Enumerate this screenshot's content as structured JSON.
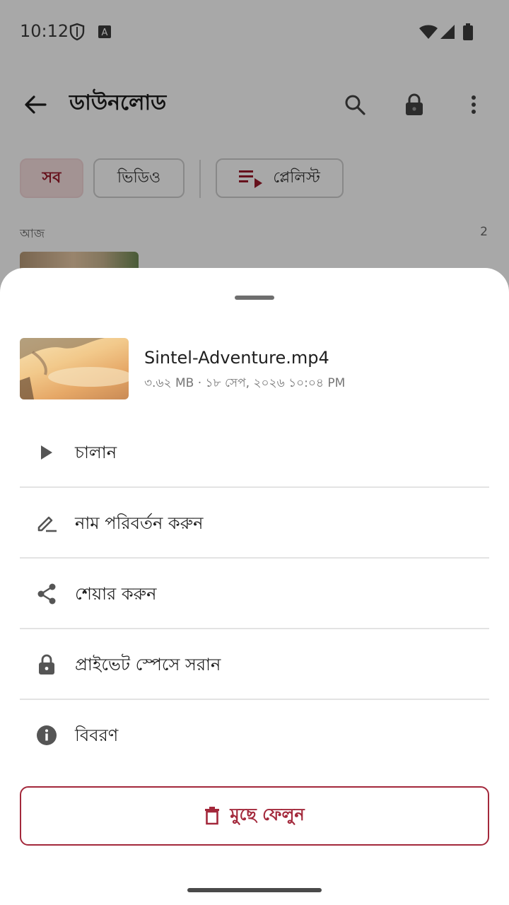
{
  "status_bar": {
    "time": "10:12"
  },
  "toolbar": {
    "title": "ডাউনলোড"
  },
  "chips": {
    "all": "সব",
    "video": "ভিডিও",
    "playlist": "প্লেলিস্ট"
  },
  "section": {
    "label": "আজ",
    "count": "2"
  },
  "sheet": {
    "file": {
      "name": "Sintel-Adventure.mp4",
      "meta": "৩.৬২ MB · ১৮ সেপ, ২০২৬ ১০:০৪ PM"
    },
    "menu": [
      {
        "label": "চালান",
        "icon": "play-icon"
      },
      {
        "label": "নাম পরিবর্তন করুন",
        "icon": "edit-icon"
      },
      {
        "label": "শেয়ার করুন",
        "icon": "share-icon"
      },
      {
        "label": "প্রাইভেট স্পেসে সরান",
        "icon": "lock-icon"
      },
      {
        "label": "বিবরণ",
        "icon": "info-icon"
      }
    ],
    "delete_label": "মুছে ফেলুন"
  },
  "colors": {
    "accent": "#a3283b",
    "scrim": "rgba(0,0,0,0.34)",
    "chip_active_bg": "#f7dfe0"
  }
}
